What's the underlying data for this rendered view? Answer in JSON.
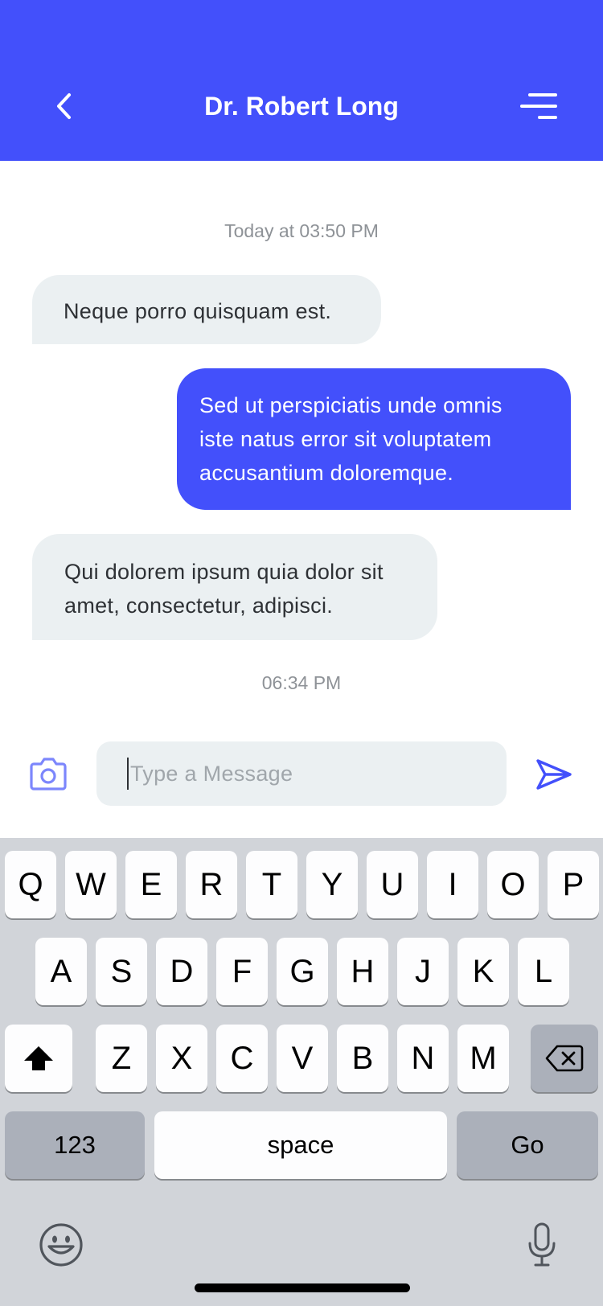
{
  "header": {
    "title": "Dr. Robert Long",
    "back_icon": "chevron-left-icon",
    "menu_icon": "menu-lines-icon",
    "color": "#4350FB"
  },
  "conversation": {
    "timestamp_top": "Today at 03:50 PM",
    "messages": [
      {
        "direction": "incoming",
        "lines": [
          "Neque porro quisquam est."
        ]
      },
      {
        "direction": "outgoing",
        "lines": [
          "Sed ut perspiciatis unde omnis",
          "iste natus error sit voluptatem",
          "accusantium doloremque."
        ]
      },
      {
        "direction": "incoming",
        "lines": [
          "Qui dolorem ipsum quia dolor sit",
          "amet, consectetur, adipisci."
        ]
      }
    ],
    "timestamp_bottom": "06:34 PM"
  },
  "composer": {
    "placeholder": "Type a Message",
    "camera_icon": "camera-icon",
    "send_icon": "send-icon"
  },
  "keyboard": {
    "row1": [
      "Q",
      "W",
      "E",
      "R",
      "T",
      "Y",
      "U",
      "I",
      "O",
      "P"
    ],
    "row2": [
      "A",
      "S",
      "D",
      "F",
      "G",
      "H",
      "J",
      "K",
      "L"
    ],
    "row3": [
      "Z",
      "X",
      "C",
      "V",
      "B",
      "N",
      "M"
    ],
    "numbers_label": "123",
    "space_label": "space",
    "go_label": "Go",
    "shift_icon": "shift-icon",
    "backspace_icon": "backspace-icon",
    "emoji_icon": "emoji-icon",
    "mic_icon": "microphone-icon"
  }
}
